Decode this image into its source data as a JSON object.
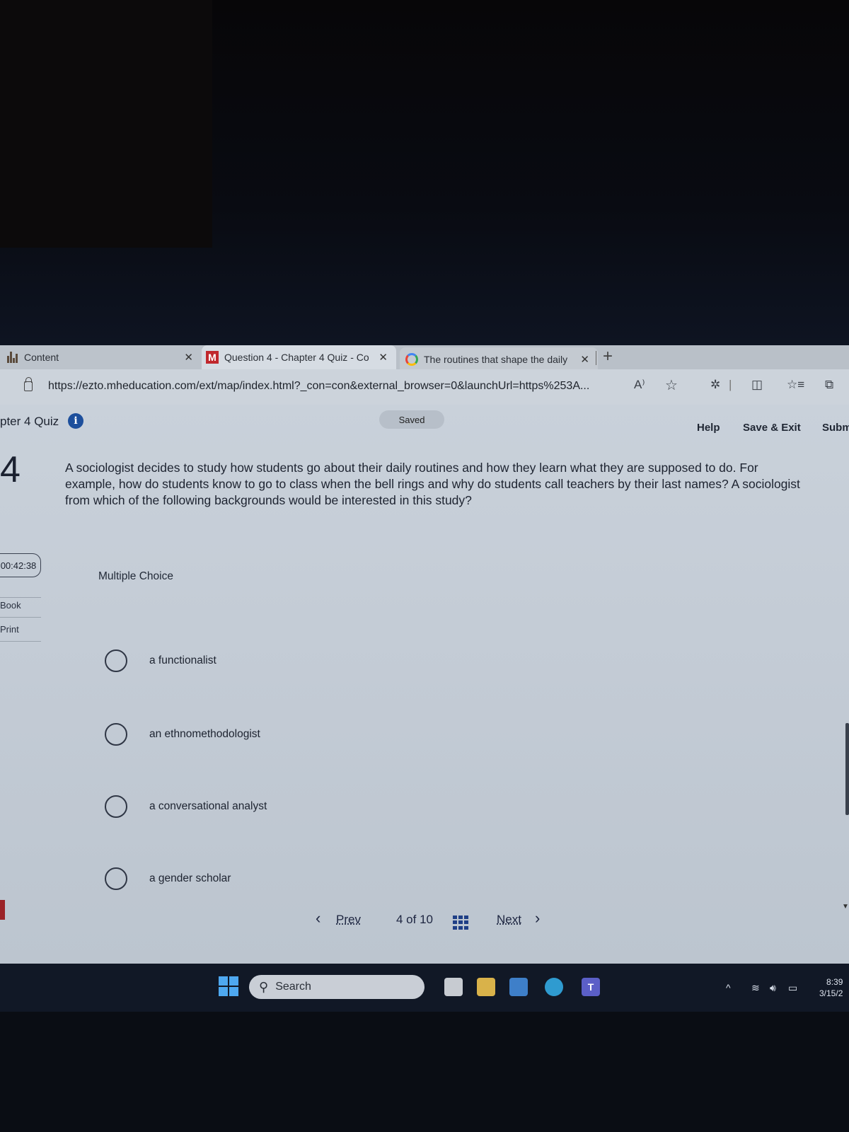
{
  "browser": {
    "tabs": [
      {
        "label": "Content",
        "icon": "course-bars-icon"
      },
      {
        "label": "Question 4 - Chapter 4 Quiz - Co",
        "icon": "mcgraw-hill-m-icon",
        "active": true
      },
      {
        "label": "The routines that shape the daily",
        "icon": "google-g-icon"
      }
    ],
    "close_glyph": "✕",
    "new_tab_glyph": "+",
    "url": "https://ezto.mheducation.com/ext/map/index.html?_con=con&external_browser=0&launchUrl=https%253A...",
    "toolbar_icons": [
      "read-aloud-icon",
      "favorite-star-icon",
      "extensions-icon",
      "split-screen-icon",
      "favorites-list-icon",
      "collections-icon"
    ],
    "read_aloud_glyph": "A⁾",
    "star_glyph": "☆"
  },
  "quiz": {
    "title": "pter 4 Quiz",
    "info_glyph": "i",
    "status": "Saved",
    "header_links": {
      "help": "Help",
      "save_exit": "Save & Exit",
      "submit": "Subm"
    },
    "question_number": "4",
    "question_text": "A sociologist decides to study how students go about their daily routines and how they learn what they are supposed to do. For example, how do students know to go to class when the bell rings and why do students call teachers by their last names? A sociologist from which of the following backgrounds would be interested in this study?",
    "timer": "00:42:38",
    "side_links": [
      "Book",
      "Print"
    ],
    "question_type": "Multiple Choice",
    "options": [
      "a functionalist",
      "an ethnomethodologist",
      "a conversational analyst",
      "a gender scholar"
    ],
    "selected_option": null,
    "pager": {
      "prev": "Prev",
      "prev_glyph": "‹",
      "position": "4 of 10",
      "next": "Next",
      "next_glyph": "›",
      "current": 4,
      "total": 10
    }
  },
  "taskbar": {
    "search_label": "Search",
    "search_glyph": "⚲",
    "pinned_apps": [
      "file-explorer-icon",
      "folder-icon",
      "mail-icon",
      "edge-icon",
      "teams-icon"
    ],
    "tray_icons": [
      "chevron-up-icon",
      "wifi-icon",
      "volume-icon",
      "battery-icon"
    ],
    "time": "8:39",
    "date": "3/15/2"
  }
}
